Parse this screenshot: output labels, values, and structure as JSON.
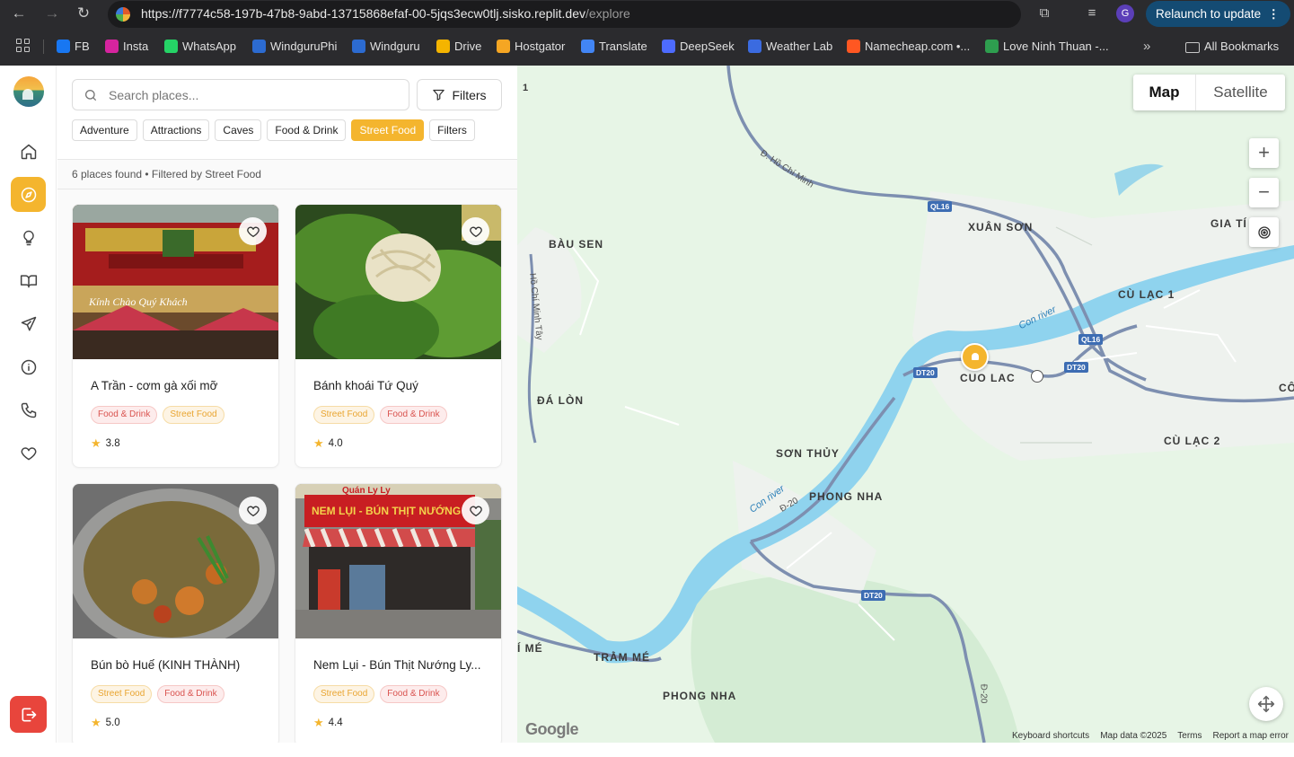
{
  "browser": {
    "url_main": "https://f7774c58-197b-47b8-9abd-13715868efaf-00-5jqs3ecw0tlj.sisko.replit.dev",
    "url_path": "/explore",
    "profile_initial": "G",
    "relaunch_label": "Relaunch to update",
    "bookmarks": [
      {
        "label": "FB",
        "color": "#1877f2"
      },
      {
        "label": "Insta",
        "color": "#d6249f"
      },
      {
        "label": "WhatsApp",
        "color": "#25d366"
      },
      {
        "label": "WindguruPhi",
        "color": "#2c6bd1"
      },
      {
        "label": "Windguru",
        "color": "#2c6bd1"
      },
      {
        "label": "Drive",
        "color": "#f4b400"
      },
      {
        "label": "Hostgator",
        "color": "#f5a623"
      },
      {
        "label": "Translate",
        "color": "#4285f4"
      },
      {
        "label": "DeepSeek",
        "color": "#4d6bfe"
      },
      {
        "label": "Weather Lab",
        "color": "#3b6be0"
      },
      {
        "label": "Namecheap.com •...",
        "color": "#ff5722"
      },
      {
        "label": "Love Ninh Thuan -...",
        "color": "#2e9e4f"
      }
    ],
    "all_bookmarks_label": "All Bookmarks"
  },
  "search": {
    "placeholder": "Search places...",
    "filters_label": "Filters"
  },
  "chips": [
    {
      "label": "Adventure",
      "active": false
    },
    {
      "label": "Attractions",
      "active": false
    },
    {
      "label": "Caves",
      "active": false
    },
    {
      "label": "Food & Drink",
      "active": false
    },
    {
      "label": "Street Food",
      "active": true
    },
    {
      "label": "Filters",
      "active": false
    }
  ],
  "results_text": "6 places found • Filtered by Street Food",
  "places": [
    {
      "name": "A Trần - cơm gà xối mỡ",
      "tags": [
        "Food & Drink",
        "Street Food"
      ],
      "rating": "3.8"
    },
    {
      "name": "Bánh khoái Tứ Quý",
      "tags": [
        "Street Food",
        "Food & Drink"
      ],
      "rating": "4.0"
    },
    {
      "name": "Bún bò Huế (KINH THÀNH)",
      "tags": [
        "Street Food",
        "Food & Drink"
      ],
      "rating": "5.0"
    },
    {
      "name": "Nem Lụi - Bún Thịt Nướng Ly...",
      "tags": [
        "Street Food",
        "Food & Drink"
      ],
      "rating": "4.4"
    }
  ],
  "photo_text": {
    "card1_sign": "Kính Chào Quý Khách",
    "card4_top": "Quán Ly Ly",
    "card4_sign": "NEM LỤI - BÚN THỊT NƯỚNG"
  },
  "map": {
    "map_label": "Map",
    "satellite_label": "Satellite",
    "zoom_in": "+",
    "zoom_out": "−",
    "corner_number": "1",
    "places": [
      "BÀU SEN",
      "XUÂN SƠN",
      "GIA TÍ",
      "CÙ LẠC 1",
      "CUO LAC",
      "ĐÁ LÒN",
      "SƠN THỦY",
      "PHONG NHA",
      "CÙ LẠC 2",
      "TRẰM MÉ",
      "PHONG NHA",
      "CÔ",
      "Í MÉ"
    ],
    "road_badges": [
      "QL16",
      "QL16",
      "DT20",
      "DT20",
      "DT20"
    ],
    "river_labels": [
      "Con river",
      "Con river"
    ],
    "road_labels": [
      "Đ. Hồ Chí Minh",
      "Hồ Chí Minh Tây",
      "Đ-20",
      "Đ-20"
    ],
    "google_logo": "Google",
    "attribution": [
      "Keyboard shortcuts",
      "Map data ©2025",
      "Terms",
      "Report a map error"
    ]
  }
}
